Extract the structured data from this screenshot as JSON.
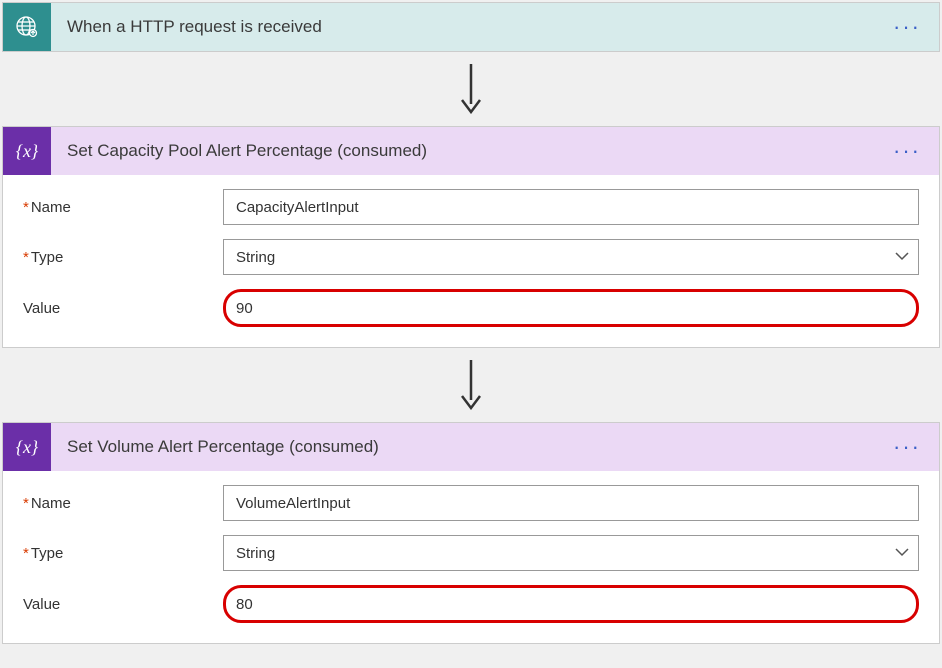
{
  "trigger": {
    "title": "When a HTTP request is received"
  },
  "step1": {
    "title": "Set Capacity Pool Alert Percentage (consumed)",
    "name_label": "Name",
    "name_value": "CapacityAlertInput",
    "type_label": "Type",
    "type_value": "String",
    "value_label": "Value",
    "value_value": "90"
  },
  "step2": {
    "title": "Set Volume Alert Percentage (consumed)",
    "name_label": "Name",
    "name_value": "VolumeAlertInput",
    "type_label": "Type",
    "type_value": "String",
    "value_label": "Value",
    "value_value": "80"
  },
  "icons": {
    "variable": "{x}"
  }
}
